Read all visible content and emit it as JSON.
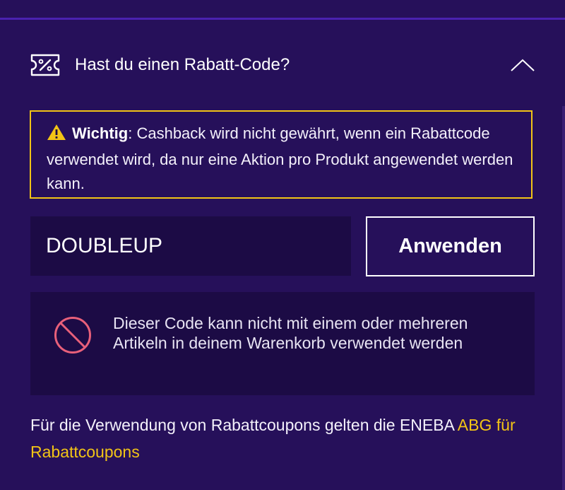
{
  "promo": {
    "title": "Hast du einen Rabatt-Code?",
    "icon": "coupon-percent-icon",
    "toggle_icon": "chevron-up-icon"
  },
  "notice": {
    "icon": "warning-icon",
    "bold": "Wichtig",
    "text": ": Cashback wird nicht gewährt, wenn ein Rabattcode verwendet wird, da nur eine Aktion pro Produkt angewendet werden kann.",
    "border_color": "#f2c416"
  },
  "code_form": {
    "value": "DOUBLEUP",
    "apply_label": "Anwenden"
  },
  "error": {
    "icon": "ban-icon",
    "message": "Dieser Code kann nicht mit einem oder mehreren Artikeln in deinem Warenkorb verwendet werden",
    "icon_color": "#e8607a"
  },
  "terms": {
    "text": "Für die Verwendung von Rabattcoupons gelten die ENEBA ",
    "link_label": "ABG für Rabattcoupons",
    "link_color": "#f2c416"
  },
  "colors": {
    "background": "#26105a",
    "panel": "#1c0b45",
    "accent": "#4a22b0"
  }
}
